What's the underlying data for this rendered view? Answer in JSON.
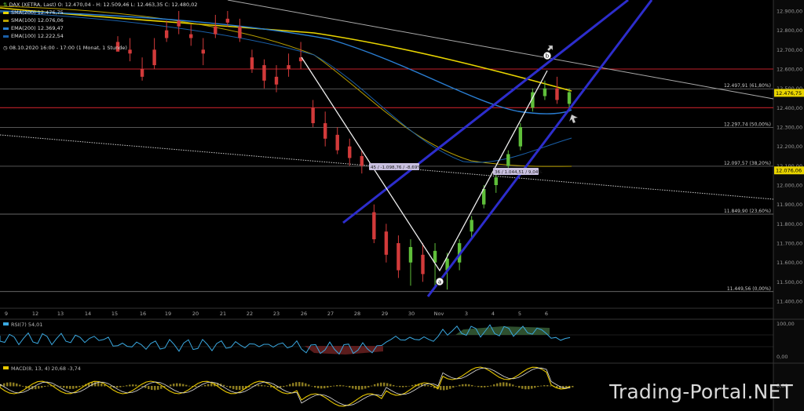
{
  "header": {
    "instrument": "DAX (XETRA, Last)",
    "ohlc": "O: 12.470,04 - H: 12.509,46 L: 12.463,35 C: 12.480,02",
    "date_range": "08.10.2020 16:00 - 17:00",
    "interval": "(1 Monat, 1 Stunde)"
  },
  "legend": [
    {
      "label": "SMA(200)",
      "value": "12.476,75",
      "color": "#e8d400"
    },
    {
      "label": "SMA(100)",
      "value": "12.076,06",
      "color": "#b8a000"
    },
    {
      "label": "EMA(200)",
      "value": "12.369,47",
      "color": "#2a7fd4"
    },
    {
      "label": "EMA(100)",
      "value": "12.222,54",
      "color": "#1a5fa8"
    }
  ],
  "chart_data": {
    "type": "candlestick",
    "ylim": [
      11400,
      12900
    ],
    "y_ticks": [
      "12.900,00",
      "12.800,00",
      "12.700,00",
      "12.600,00",
      "12.500,00",
      "12.400,00",
      "12.300,00",
      "12.200,00",
      "12.100,00",
      "12.000,00",
      "11.900,00",
      "11.800,00",
      "11.700,00",
      "11.600,00",
      "11.500,00",
      "11.400,00"
    ],
    "x_tick_labels": [
      "9",
      "12",
      "13",
      "14",
      "15",
      "16",
      "19",
      "20",
      "21",
      "22",
      "23",
      "26",
      "27",
      "28",
      "29",
      "30",
      "Nov",
      "3",
      "4",
      "5",
      "6"
    ],
    "fib_levels": [
      {
        "value": 12497.91,
        "label": "12.497,91 (61,80%)"
      },
      {
        "value": 12297.74,
        "label": "12.297,74 (50,00%)"
      },
      {
        "value": 12097.57,
        "label": "12.097,57 (38,20%)"
      },
      {
        "value": 11849.9,
        "label": "11.849,90 (23,60%)"
      },
      {
        "value": 11449.56,
        "label": "11.449,56 (0,00%)"
      }
    ],
    "resistance_lines": [
      12600,
      12400
    ],
    "price_badges": [
      {
        "value": 12476.75,
        "label": "12.476,75",
        "bg": "#e8d400"
      },
      {
        "value": 12076.06,
        "label": "12.076,06",
        "bg": "#e8d400"
      }
    ],
    "wave_markers": [
      "a",
      "b"
    ],
    "annotations": [
      "45 / -1.098,76 / -8,69%",
      "36 / 1.044,51 / 9,04%"
    ],
    "candles": [
      [
        12740,
        12770,
        12700,
        12690
      ],
      [
        12700,
        12760,
        12640,
        12680
      ],
      [
        12600,
        12660,
        12540,
        12560
      ],
      [
        12700,
        12760,
        12600,
        12620
      ],
      [
        12800,
        12850,
        12740,
        12760
      ],
      [
        12850,
        12900,
        12780,
        12820
      ],
      [
        12780,
        12830,
        12720,
        12760
      ],
      [
        12700,
        12760,
        12620,
        12680
      ],
      [
        12820,
        12880,
        12760,
        12780
      ],
      [
        12860,
        12900,
        12820,
        12840
      ],
      [
        12820,
        12860,
        12740,
        12760
      ],
      [
        12660,
        12700,
        12580,
        12600
      ],
      [
        12620,
        12650,
        12500,
        12540
      ],
      [
        12560,
        12620,
        12480,
        12520
      ],
      [
        12620,
        12680,
        12560,
        12600
      ],
      [
        12660,
        12740,
        12600,
        12640
      ],
      [
        12400,
        12440,
        12300,
        12320
      ],
      [
        12320,
        12380,
        12200,
        12240
      ],
      [
        12260,
        12300,
        12160,
        12180
      ],
      [
        12200,
        12240,
        12100,
        12140
      ],
      [
        12150,
        12180,
        12060,
        12100
      ],
      [
        11860,
        11900,
        11700,
        11720
      ],
      [
        11760,
        11800,
        11600,
        11640
      ],
      [
        11700,
        11740,
        11520,
        11560
      ],
      [
        11600,
        11720,
        11480,
        11680
      ],
      [
        11640,
        11700,
        11500,
        11540
      ],
      [
        11600,
        11700,
        11480,
        11660
      ],
      [
        11560,
        11650,
        11460,
        11620
      ],
      [
        11600,
        11720,
        11560,
        11700
      ],
      [
        11760,
        11840,
        11720,
        11820
      ],
      [
        11900,
        12000,
        11880,
        11980
      ],
      [
        12000,
        12060,
        11960,
        12040
      ],
      [
        12100,
        12180,
        12080,
        12160
      ],
      [
        12200,
        12320,
        12180,
        12300
      ],
      [
        12400,
        12500,
        12380,
        12480
      ],
      [
        12460,
        12540,
        12440,
        12500
      ],
      [
        12500,
        12560,
        12420,
        12440
      ],
      [
        12420,
        12500,
        12380,
        12480
      ]
    ],
    "rsi": {
      "label": "RSI(7)",
      "value": "54,01",
      "ylim": [
        0,
        100
      ],
      "ticks": [
        "100,00",
        "0,00"
      ]
    },
    "macd": {
      "label": "MACD(8, 13, 4)",
      "values": [
        "20,68",
        "-3,74"
      ],
      "tick": "0,00"
    }
  },
  "watermark": "Trading-Portal.NET"
}
